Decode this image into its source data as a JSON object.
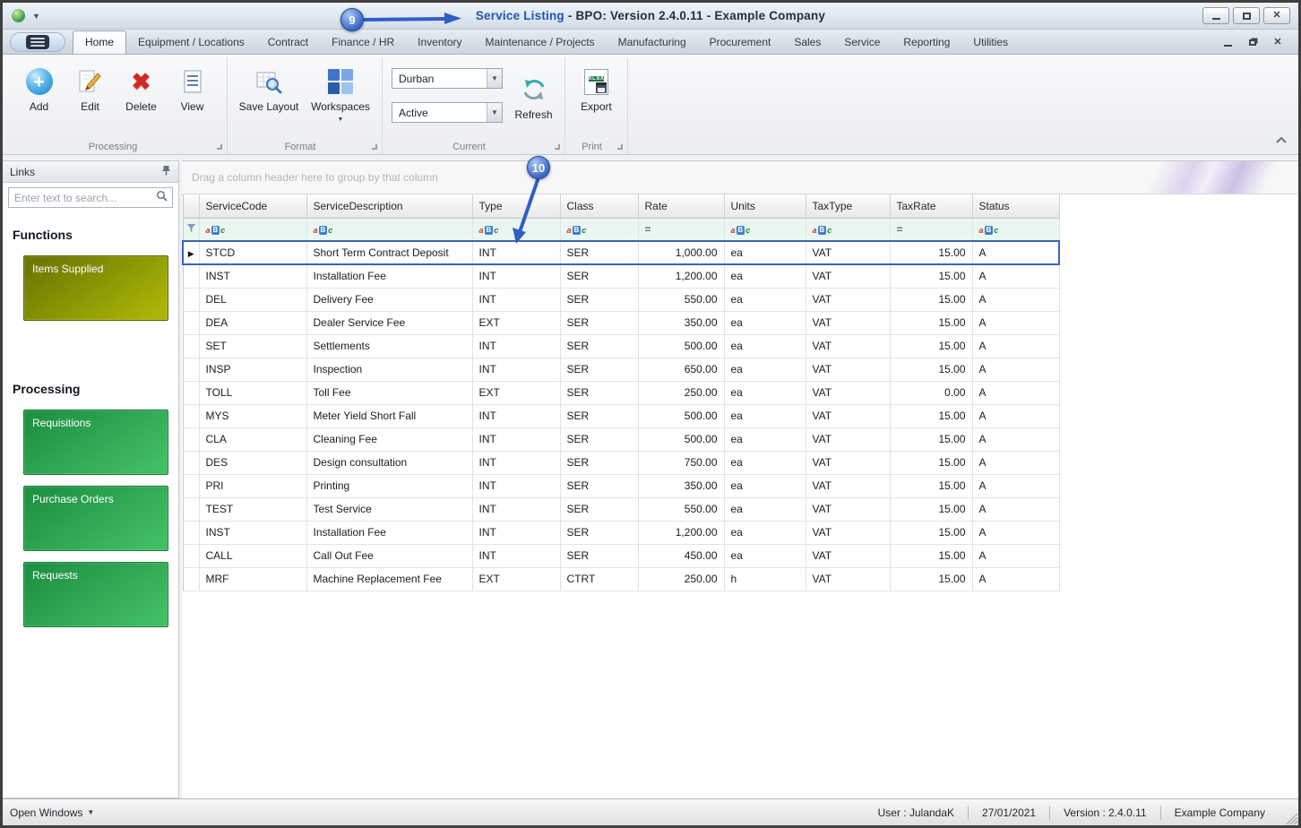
{
  "window": {
    "title_primary": "Service Listing",
    "title_secondary": " - BPO: Version 2.4.0.11 - Example Company"
  },
  "ribbon": {
    "tabs": [
      "Home",
      "Equipment / Locations",
      "Contract",
      "Finance / HR",
      "Inventory",
      "Maintenance / Projects",
      "Manufacturing",
      "Procurement",
      "Sales",
      "Service",
      "Reporting",
      "Utilities"
    ],
    "active_tab": "Home",
    "buttons": {
      "add": "Add",
      "edit": "Edit",
      "delete": "Delete",
      "view": "View",
      "save_layout": "Save Layout",
      "workspaces": "Workspaces",
      "refresh": "Refresh",
      "export": "Export"
    },
    "branch_value": "Durban",
    "state_value": "Active",
    "group_labels": {
      "processing": "Processing",
      "format": "Format",
      "current": "Current",
      "print": "Print"
    }
  },
  "sidebar": {
    "title": "Links",
    "search_placeholder": "Enter text to search...",
    "functions_heading": "Functions",
    "functions_items": [
      "Items Supplied"
    ],
    "processing_heading": "Processing",
    "processing_items": [
      "Requisitions",
      "Purchase Orders",
      "Requests"
    ]
  },
  "grid": {
    "group_hint": "Drag a column header here to group by that column",
    "columns": [
      {
        "label": "ServiceCode",
        "filter": "abc",
        "align": "left"
      },
      {
        "label": "ServiceDescription",
        "filter": "abc",
        "align": "left"
      },
      {
        "label": "Type",
        "filter": "abc",
        "align": "left"
      },
      {
        "label": "Class",
        "filter": "abc",
        "align": "left"
      },
      {
        "label": "Rate",
        "filter": "eq",
        "align": "right"
      },
      {
        "label": "Units",
        "filter": "abc",
        "align": "left"
      },
      {
        "label": "TaxType",
        "filter": "abc",
        "align": "left"
      },
      {
        "label": "TaxRate",
        "filter": "eq",
        "align": "right"
      },
      {
        "label": "Status",
        "filter": "abc",
        "align": "left"
      }
    ],
    "selected_row_index": 0,
    "rows": [
      [
        "STCD",
        "Short Term Contract Deposit",
        "INT",
        "SER",
        "1,000.00",
        "ea",
        "VAT",
        "15.00",
        "A"
      ],
      [
        "INST",
        "Installation Fee",
        "INT",
        "SER",
        "1,200.00",
        "ea",
        "VAT",
        "15.00",
        "A"
      ],
      [
        "DEL",
        "Delivery Fee",
        "INT",
        "SER",
        "550.00",
        "ea",
        "VAT",
        "15.00",
        "A"
      ],
      [
        "DEA",
        "Dealer Service Fee",
        "EXT",
        "SER",
        "350.00",
        "ea",
        "VAT",
        "15.00",
        "A"
      ],
      [
        "SET",
        "Settlements",
        "INT",
        "SER",
        "500.00",
        "ea",
        "VAT",
        "15.00",
        "A"
      ],
      [
        "INSP",
        "Inspection",
        "INT",
        "SER",
        "650.00",
        "ea",
        "VAT",
        "15.00",
        "A"
      ],
      [
        "TOLL",
        "Toll Fee",
        "EXT",
        "SER",
        "250.00",
        "ea",
        "VAT",
        "0.00",
        "A"
      ],
      [
        "MYS",
        "Meter Yield Short Fall",
        "INT",
        "SER",
        "500.00",
        "ea",
        "VAT",
        "15.00",
        "A"
      ],
      [
        "CLA",
        "Cleaning Fee",
        "INT",
        "SER",
        "500.00",
        "ea",
        "VAT",
        "15.00",
        "A"
      ],
      [
        "DES",
        "Design consultation",
        "INT",
        "SER",
        "750.00",
        "ea",
        "VAT",
        "15.00",
        "A"
      ],
      [
        "PRI",
        "Printing",
        "INT",
        "SER",
        "350.00",
        "ea",
        "VAT",
        "15.00",
        "A"
      ],
      [
        "TEST",
        "Test Service",
        "INT",
        "SER",
        "550.00",
        "ea",
        "VAT",
        "15.00",
        "A"
      ],
      [
        "INST",
        "Installation Fee",
        "INT",
        "SER",
        "1,200.00",
        "ea",
        "VAT",
        "15.00",
        "A"
      ],
      [
        "CALL",
        "Call Out Fee",
        "INT",
        "SER",
        "450.00",
        "ea",
        "VAT",
        "15.00",
        "A"
      ],
      [
        "MRF",
        "Machine Replacement Fee",
        "EXT",
        "CTRT",
        "250.00",
        "h",
        "VAT",
        "15.00",
        "A"
      ]
    ]
  },
  "statusbar": {
    "open_windows": "Open Windows",
    "user": "User : JulandaK",
    "date": "27/01/2021",
    "version": "Version : 2.4.0.11",
    "company": "Example Company"
  },
  "annotations": {
    "badge9": "9",
    "badge10": "10"
  },
  "colors": {
    "annotation_blue": "#2e5ec6",
    "selection_border": "#3a64b8",
    "sidebar_olive": "#8b9605",
    "sidebar_green": "#2a9e4f",
    "filter_row": "#e9f7f0",
    "title_highlight": "#1d55b4"
  }
}
